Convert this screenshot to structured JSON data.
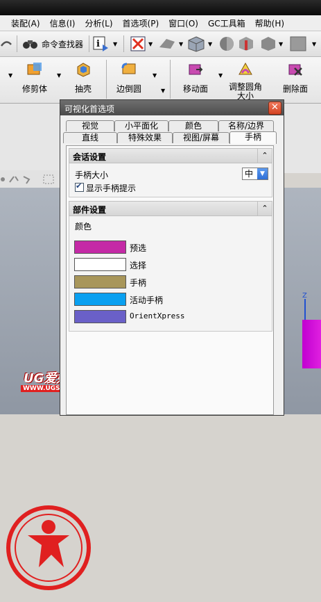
{
  "menubar": {
    "items": [
      "装配(A)",
      "信息(I)",
      "分析(L)",
      "首选项(P)",
      "窗口(O)",
      "GC工具箱",
      "帮助(H)"
    ]
  },
  "toolbar": {
    "command_finder_label": "命令查找器"
  },
  "ribbon": {
    "buttons": [
      {
        "label": "修剪体"
      },
      {
        "label": "抽壳"
      },
      {
        "label": "边倒圆"
      },
      {
        "label": "移动面"
      },
      {
        "label": "调整圆角",
        "sublabel": "大小"
      },
      {
        "label": "删除面"
      }
    ]
  },
  "dialog": {
    "title": "可视化首选项",
    "tabs_row1": [
      "视觉",
      "小平面化",
      "颜色",
      "名称/边界"
    ],
    "tabs_row2": [
      "直线",
      "特殊效果",
      "视图/屏幕",
      "手柄"
    ],
    "active_tab": "手柄",
    "session": {
      "title": "会话设置",
      "handle_size_label": "手柄大小",
      "handle_size_value": "中",
      "show_tips_label": "显示手柄提示",
      "show_tips_checked": true
    },
    "part": {
      "title": "部件设置",
      "color_label": "颜色",
      "colors": [
        {
          "label": "预选",
          "color": "#c42aa6"
        },
        {
          "label": "选择",
          "color": "#ffffff"
        },
        {
          "label": "手柄",
          "color": "#a8965a"
        },
        {
          "label": "活动手柄",
          "color": "#0aa0f0"
        },
        {
          "label": "OrientXpress",
          "color": "#6a60c8"
        }
      ]
    }
  },
  "viewport": {
    "axis_label": "Z"
  },
  "watermark": {
    "brand": "UG爱好者",
    "url": "WWW.UGSNX.COM"
  }
}
